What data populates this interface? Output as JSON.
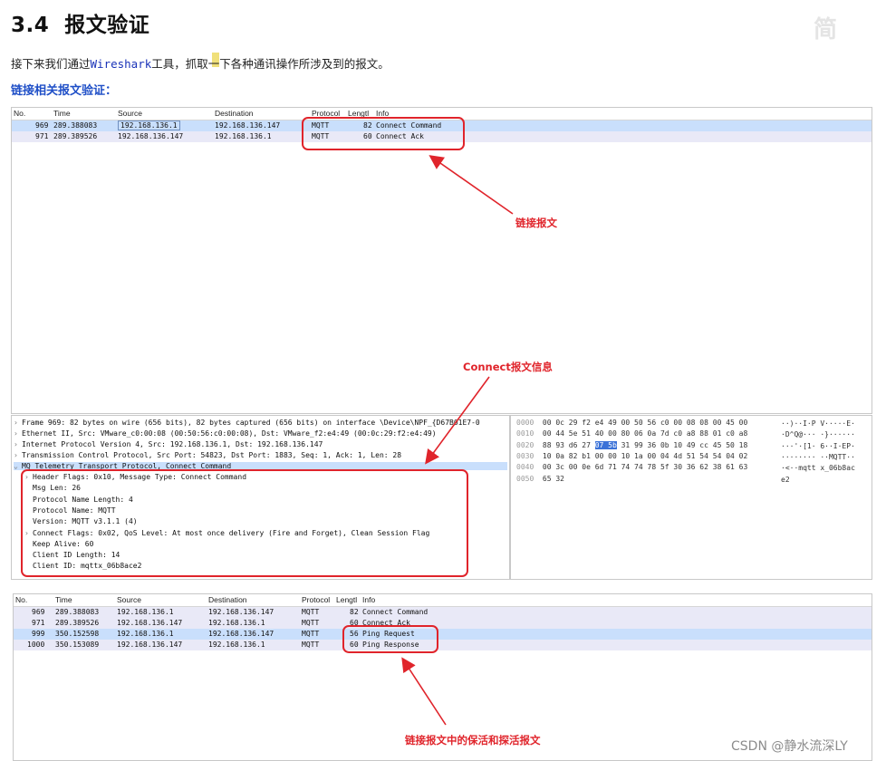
{
  "heading": {
    "number": "3.4",
    "text": "报文验证"
  },
  "watermark_top": "简",
  "intro": {
    "before": "接下来我们通过",
    "tool": "Wireshark",
    "after": "工具，抓取一下各种通讯操作所涉及到的报文。"
  },
  "subheading": "链接相关报文验证：",
  "columns": {
    "no": "No.",
    "time": "Time",
    "source": "Source",
    "destination": "Destination",
    "protocol": "Protocol",
    "length": "Lengtl",
    "info": "Info"
  },
  "capture1": {
    "rows": [
      {
        "no": "969",
        "time": "289.388083",
        "source": "192.168.136.1",
        "destination": "192.168.136.147",
        "protocol": "MQTT",
        "length": "82",
        "info": "Connect Command"
      },
      {
        "no": "971",
        "time": "289.389526",
        "source": "192.168.136.147",
        "destination": "192.168.136.1",
        "protocol": "MQTT",
        "length": "60",
        "info": "Connect Ack"
      }
    ]
  },
  "annotations": {
    "connect_packets": "链接报文",
    "connect_info": "Connect报文信息",
    "keepalive_packets": "链接报文中的保活和探活报文"
  },
  "details": {
    "frame": "Frame 969: 82 bytes on wire (656 bits), 82 bytes captured (656 bits) on interface \\Device\\NPF_{D67B01E7-0",
    "ethernet": "Ethernet II, Src: VMware_c0:00:08 (00:50:56:c0:00:08), Dst: VMware_f2:e4:49 (00:0c:29:f2:e4:49)",
    "ip": "Internet Protocol Version 4, Src: 192.168.136.1, Dst: 192.168.136.147",
    "tcp": "Transmission Control Protocol, Src Port: 54823, Dst Port: 1883, Seq: 1, Ack: 1, Len: 28",
    "mqtt": "MQ Telemetry Transport Protocol, Connect Command",
    "fields": [
      {
        "expandable": true,
        "text": "Header Flags: 0x10, Message Type: Connect Command"
      },
      {
        "expandable": false,
        "text": "Msg Len: 26"
      },
      {
        "expandable": false,
        "text": "Protocol Name Length: 4"
      },
      {
        "expandable": false,
        "text": "Protocol Name: MQTT"
      },
      {
        "expandable": false,
        "text": "Version: MQTT v3.1.1 (4)"
      },
      {
        "expandable": true,
        "text": "Connect Flags: 0x02, QoS Level: At most once delivery (Fire and Forget), Clean Session Flag"
      },
      {
        "expandable": false,
        "text": "Keep Alive: 60"
      },
      {
        "expandable": false,
        "text": "Client ID Length: 14"
      },
      {
        "expandable": false,
        "text": "Client ID: mqttx_06b8ace2"
      }
    ]
  },
  "hex": [
    {
      "offset": "0000",
      "pre": "00 0c 29 f2 e4 49 00 50  56 c0 00 08 08 00 45 00",
      "hl": "",
      "post": "",
      "ascii": "··)··I·P V·····E·"
    },
    {
      "offset": "0010",
      "pre": "00 44 5e 51 40 00 80 06  0a 7d c0 a8 88 01 c0 a8",
      "hl": "",
      "post": "",
      "ascii": "·D^Q@··· ·}······"
    },
    {
      "offset": "0020",
      "pre": "88 93 d6 27 ",
      "hl": "07 5b",
      "post": " 31 99  36 0b 10 49 cc 45 50 18",
      "ascii": "···'·[1· 6··I·EP·"
    },
    {
      "offset": "0030",
      "pre": "10 0a 82 b1 00 00 10 1a  00 04 4d 51 54 54 04 02",
      "hl": "",
      "post": "",
      "ascii": "········ ··MQTT··"
    },
    {
      "offset": "0040",
      "pre": "00 3c 00 0e 6d 71 74 74  78 5f 30 36 62 38 61 63",
      "hl": "",
      "post": "",
      "ascii": "·<··mqtt x_06b8ac"
    },
    {
      "offset": "0050",
      "pre": "65 32",
      "hl": "",
      "post": "",
      "ascii": "e2"
    }
  ],
  "capture2": {
    "rows": [
      {
        "no": "969",
        "time": "289.388083",
        "source": "192.168.136.1",
        "destination": "192.168.136.147",
        "protocol": "MQTT",
        "length": "82",
        "info": "Connect Command"
      },
      {
        "no": "971",
        "time": "289.389526",
        "source": "192.168.136.147",
        "destination": "192.168.136.1",
        "protocol": "MQTT",
        "length": "60",
        "info": "Connect Ack"
      },
      {
        "no": "999",
        "time": "350.152598",
        "source": "192.168.136.1",
        "destination": "192.168.136.147",
        "protocol": "MQTT",
        "length": "56",
        "info": "Ping Request"
      },
      {
        "no": "1000",
        "time": "350.153089",
        "source": "192.168.136.147",
        "destination": "192.168.136.1",
        "protocol": "MQTT",
        "length": "60",
        "info": "Ping Response"
      }
    ]
  },
  "credit": "CSDN @静水流深LY",
  "colors": {
    "annotation_red": "#e0242b",
    "selection_blue": "#c9dffc",
    "link_blue": "#1f4fc7"
  }
}
